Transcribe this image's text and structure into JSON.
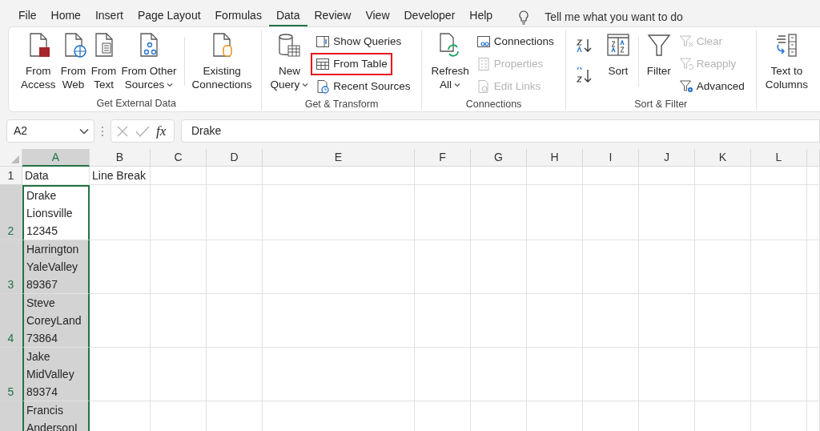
{
  "menu_tabs": [
    {
      "label": "File",
      "selected": false
    },
    {
      "label": "Home",
      "selected": false
    },
    {
      "label": "Insert",
      "selected": false
    },
    {
      "label": "Page Layout",
      "selected": false
    },
    {
      "label": "Formulas",
      "selected": false
    },
    {
      "label": "Data",
      "selected": true
    },
    {
      "label": "Review",
      "selected": false
    },
    {
      "label": "View",
      "selected": false
    },
    {
      "label": "Developer",
      "selected": false
    },
    {
      "label": "Help",
      "selected": false
    }
  ],
  "tell_me": {
    "placeholder": "Tell me what you want to do"
  },
  "ribbon_groups": [
    {
      "label": "Get External Data",
      "items": [
        {
          "kind": "large",
          "lines": [
            "From",
            "Access"
          ],
          "dropdown": false
        },
        {
          "kind": "large",
          "lines": [
            "From",
            "Web"
          ],
          "dropdown": false
        },
        {
          "kind": "large",
          "lines": [
            "From",
            "Text"
          ],
          "dropdown": false
        },
        {
          "kind": "large",
          "lines": [
            "From Other",
            "Sources"
          ],
          "dropdown": true
        },
        {
          "kind": "separator"
        },
        {
          "kind": "large",
          "lines": [
            "Existing",
            "Connections"
          ],
          "dropdown": false
        }
      ]
    },
    {
      "label": "Get & Transform",
      "items": [
        {
          "kind": "large",
          "lines": [
            "New",
            "Query"
          ],
          "dropdown": true
        },
        {
          "kind": "stack",
          "entries": [
            {
              "label": "Show Queries",
              "disabled": false,
              "highlighted": false
            },
            {
              "label": "From Table",
              "disabled": false,
              "highlighted": true
            },
            {
              "label": "Recent Sources",
              "disabled": false,
              "highlighted": false
            }
          ]
        }
      ]
    },
    {
      "label": "Connections",
      "items": [
        {
          "kind": "large",
          "lines": [
            "Refresh",
            "All"
          ],
          "dropdown": true
        },
        {
          "kind": "stack",
          "entries": [
            {
              "label": "Connections",
              "disabled": false,
              "highlighted": false
            },
            {
              "label": "Properties",
              "disabled": true,
              "highlighted": false
            },
            {
              "label": "Edit Links",
              "disabled": true,
              "highlighted": false
            }
          ]
        }
      ]
    },
    {
      "label": "Sort & Filter",
      "items": [
        {
          "kind": "sort-icons"
        },
        {
          "kind": "large",
          "lines": [
            "Sort"
          ],
          "dropdown": false
        },
        {
          "kind": "separator"
        },
        {
          "kind": "large",
          "lines": [
            "Filter"
          ],
          "dropdown": false
        },
        {
          "kind": "stack",
          "entries": [
            {
              "label": "Clear",
              "disabled": true,
              "highlighted": false
            },
            {
              "label": "Reapply",
              "disabled": true,
              "highlighted": false
            },
            {
              "label": "Advanced",
              "disabled": false,
              "highlighted": false
            }
          ]
        }
      ]
    },
    {
      "items": [
        {
          "kind": "large",
          "lines": [
            "Text to",
            "Columns"
          ],
          "dropdown": false
        }
      ]
    }
  ],
  "name_box": {
    "value": "A2"
  },
  "formula_bar": {
    "function_label": "fx",
    "value": "Drake"
  },
  "sheet": {
    "columns": [
      {
        "label": "A",
        "selected": true
      },
      {
        "label": "B",
        "selected": false
      },
      {
        "label": "C",
        "selected": false
      },
      {
        "label": "D",
        "selected": false
      },
      {
        "label": "E",
        "selected": false
      },
      {
        "label": "F",
        "selected": false
      },
      {
        "label": "G",
        "selected": false
      },
      {
        "label": "H",
        "selected": false
      },
      {
        "label": "I",
        "selected": false
      },
      {
        "label": "J",
        "selected": false
      },
      {
        "label": "K",
        "selected": false
      },
      {
        "label": "L",
        "selected": false
      }
    ],
    "rows": [
      {
        "number": "1",
        "selected": false,
        "active": false,
        "cells": [
          "Data",
          "Line Break"
        ]
      },
      {
        "number": "2",
        "selected": true,
        "active": true,
        "cells": [
          "Drake\nLionsville\n12345"
        ]
      },
      {
        "number": "3",
        "selected": true,
        "active": false,
        "cells": [
          "Harrington\nYaleValley\n89367"
        ]
      },
      {
        "number": "4",
        "selected": true,
        "active": false,
        "cells": [
          "Steve\nCoreyLand\n73864"
        ]
      },
      {
        "number": "5",
        "selected": true,
        "active": false,
        "cells": [
          "Jake\nMidValley\n89374"
        ]
      },
      {
        "selected": true,
        "active": false,
        "cells": [
          "Francis\nAndersonL"
        ]
      }
    ]
  }
}
